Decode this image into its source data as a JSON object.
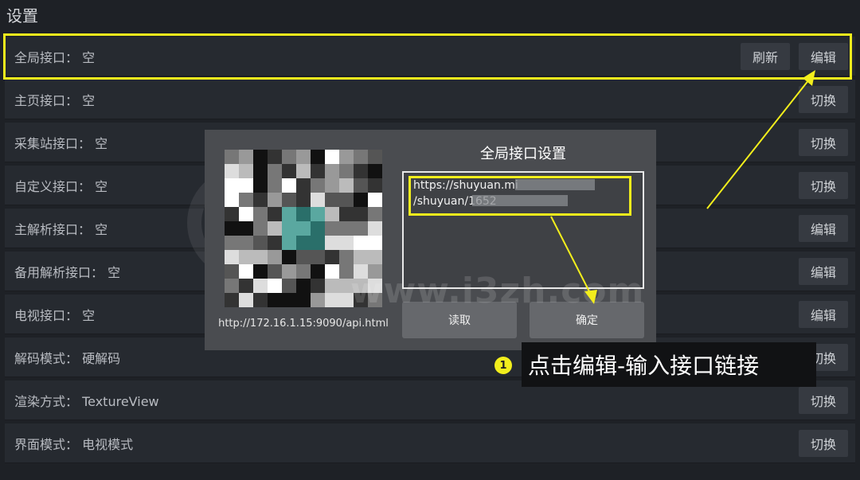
{
  "page": {
    "title": "设置"
  },
  "rows": [
    {
      "label": "全局接口：  空",
      "buttons": [
        "刷新",
        "编辑"
      ]
    },
    {
      "label": "主页接口：  空",
      "buttons": [
        "切换"
      ]
    },
    {
      "label": "采集站接口：  空",
      "buttons": [
        "切换"
      ]
    },
    {
      "label": "自定义接口：  空",
      "buttons": [
        "切换"
      ]
    },
    {
      "label": "主解析接口：  空",
      "buttons": [
        "编辑"
      ]
    },
    {
      "label": "备用解析接口：  空",
      "buttons": [
        "编辑"
      ]
    },
    {
      "label": "电视接口：  空",
      "buttons": [
        "编辑"
      ]
    },
    {
      "label": "解码模式：  硬解码",
      "buttons": [
        "切换"
      ]
    },
    {
      "label": "渲染方式：  TextureView",
      "buttons": [
        "切换"
      ]
    },
    {
      "label": "界面模式：  电视模式",
      "buttons": [
        "切换"
      ]
    }
  ],
  "dialog": {
    "title": "全局接口设置",
    "qr_url": "http://172.16.1.15:9090/api.html",
    "input_value": "https://shuyuan.mi\n/shuyuan/1652",
    "read_button": "读取",
    "ok_button": "确定"
  },
  "watermark": {
    "text": "www.i3zh.com"
  },
  "annotation": {
    "step": "1",
    "text": "点击编辑-输入接口链接"
  },
  "colors": {
    "highlight": "#f2ee1c",
    "background": "#1e2126",
    "row": "#262a30",
    "dialog": "#4a4c50"
  }
}
